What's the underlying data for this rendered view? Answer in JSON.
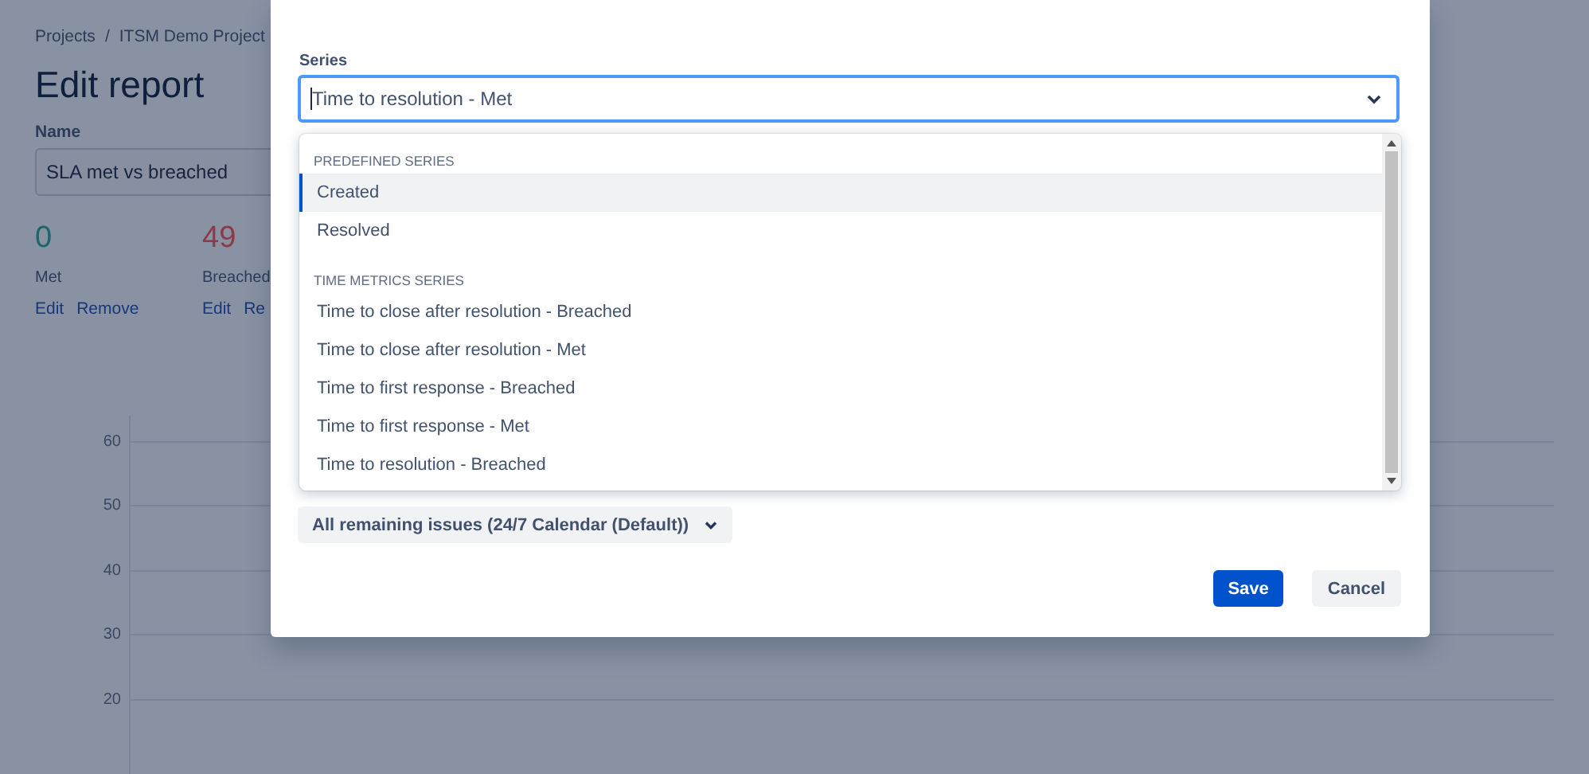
{
  "breadcrumbs": [
    "Projects",
    "ITSM Demo Project"
  ],
  "breadcrumb_separator": "/",
  "page_title": "Edit report",
  "name_field": {
    "label": "Name",
    "value": "SLA met vs breached"
  },
  "series_stats": [
    {
      "value": "0",
      "label": "Met",
      "color": "#1f666c",
      "actions": [
        "Edit",
        "Remove"
      ]
    },
    {
      "value": "49",
      "label": "Breached",
      "color": "#8c3a47",
      "actions": [
        "Edit",
        "Re"
      ]
    }
  ],
  "chart": {
    "yticks": [
      "60",
      "50",
      "40",
      "30",
      "20"
    ]
  },
  "modal": {
    "series_field": {
      "label": "Series",
      "value": "Time to resolution - Met"
    },
    "dropdown": {
      "groups": [
        {
          "heading": "PREDEFINED SERIES",
          "options": [
            {
              "label": "Created",
              "selected": true
            },
            {
              "label": "Resolved",
              "selected": false
            }
          ]
        },
        {
          "heading": "TIME METRICS SERIES",
          "options": [
            {
              "label": "Time to close after resolution - Breached",
              "selected": false
            },
            {
              "label": "Time to close after resolution - Met",
              "selected": false
            },
            {
              "label": "Time to first response - Breached",
              "selected": false
            },
            {
              "label": "Time to first response - Met",
              "selected": false
            },
            {
              "label": "Time to resolution - Breached",
              "selected": false
            }
          ]
        }
      ]
    },
    "filter_button": "All remaining issues (24/7 Calendar (Default))",
    "buttons": [
      {
        "label": "Save",
        "kind": "primary"
      },
      {
        "label": "Cancel",
        "kind": "subtle"
      }
    ]
  }
}
